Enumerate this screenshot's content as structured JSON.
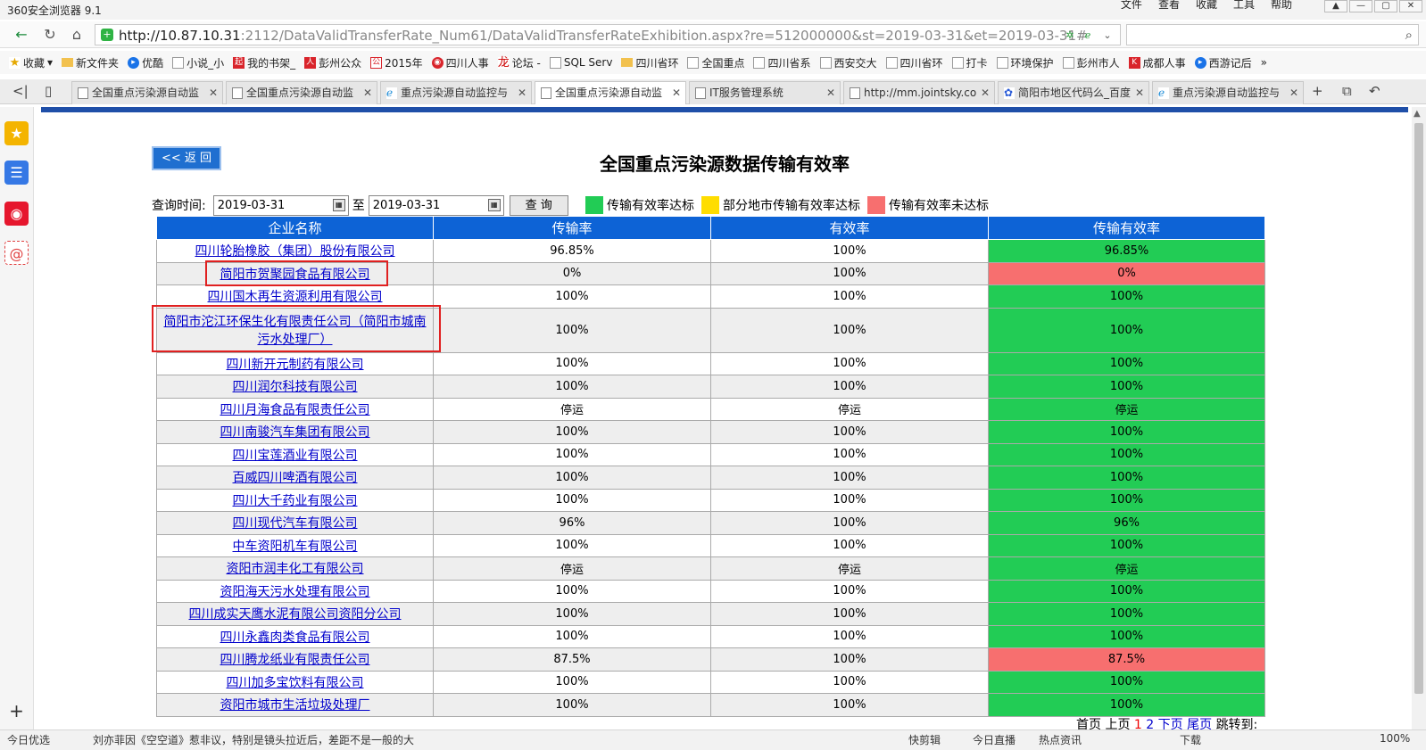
{
  "browser": {
    "app_title": "360安全浏览器 9.1",
    "menus": [
      "文件",
      "查看",
      "收藏",
      "工具",
      "帮助"
    ],
    "url_host": "http://10.87.10.31",
    "url_rest": ":2112/DataValidTransferRate_Num61/DataValidTransferRateExhibition.aspx?re=512000000&st=2019-03-31&et=2019-03-31#",
    "bookmarks": [
      "收藏",
      "新文件夹",
      "优酷",
      "小说_小",
      "我的书架_",
      "彭州公众",
      "2015年",
      "四川人事",
      "论坛 -",
      "SQL Serv",
      "四川省环",
      "全国重点",
      "四川省系",
      "西安交大",
      "四川省环",
      "打卡",
      "环境保护",
      "彭州市人",
      "成都人事",
      "西游记后"
    ],
    "tabs": [
      "全国重点污染源自动监",
      "全国重点污染源自动监",
      "重点污染源自动监控与",
      "全国重点污染源自动监",
      "IT服务管理系统",
      "http://mm.jointsky.co",
      "简阳市地区代码么_百度",
      "重点污染源自动监控与"
    ],
    "status": [
      "今日优选",
      "刘亦菲因《空空道》惹非议，特别是镜头拉近后，差距不是一般的大",
      "快剪辑",
      "今日直播",
      "热点资讯",
      "下载",
      "100%"
    ]
  },
  "page": {
    "back_label": "<< 返 回",
    "title": "全国重点污染源数据传输有效率",
    "query_label": "查询时间:",
    "date_from": "2019-03-31",
    "to_label": "至",
    "date_to": "2019-03-31",
    "query_button": "查 询",
    "legend": [
      {
        "label": "传输有效率达标",
        "color": "#22cc55"
      },
      {
        "label": "部分地市传输有效率达标",
        "color": "#ffdd00"
      },
      {
        "label": "传输有效率未达标",
        "color": "#f76f6f"
      }
    ],
    "colors": {
      "header": "#0d63d6",
      "ok": "#22cc55",
      "bad": "#f76f6f",
      "highlight": "#e02020"
    }
  },
  "table": {
    "columns": [
      "企业名称",
      "传输率",
      "有效率",
      "传输有效率"
    ],
    "rows": [
      {
        "name": "四川轮胎橡胶（集团）股份有限公司",
        "transfer": "96.85%",
        "valid": "100%",
        "rate": "96.85%",
        "status": "ok"
      },
      {
        "name": "简阳市贺聚园食品有限公司",
        "transfer": "0%",
        "valid": "100%",
        "rate": "0%",
        "status": "bad"
      },
      {
        "name": "四川国木再生资源利用有限公司",
        "transfer": "100%",
        "valid": "100%",
        "rate": "100%",
        "status": "ok"
      },
      {
        "name": "简阳市沱江环保生化有限责任公司（简阳市城南污水处理厂）",
        "transfer": "100%",
        "valid": "100%",
        "rate": "100%",
        "status": "ok"
      },
      {
        "name": "四川新开元制药有限公司",
        "transfer": "100%",
        "valid": "100%",
        "rate": "100%",
        "status": "ok"
      },
      {
        "name": "四川润尔科技有限公司",
        "transfer": "100%",
        "valid": "100%",
        "rate": "100%",
        "status": "ok"
      },
      {
        "name": "四川月海食品有限责任公司",
        "transfer": "停运",
        "valid": "停运",
        "rate": "停运",
        "status": "ok"
      },
      {
        "name": "四川南骏汽车集团有限公司",
        "transfer": "100%",
        "valid": "100%",
        "rate": "100%",
        "status": "ok"
      },
      {
        "name": "四川宝莲酒业有限公司",
        "transfer": "100%",
        "valid": "100%",
        "rate": "100%",
        "status": "ok"
      },
      {
        "name": "百威四川啤酒有限公司",
        "transfer": "100%",
        "valid": "100%",
        "rate": "100%",
        "status": "ok"
      },
      {
        "name": "四川大千药业有限公司",
        "transfer": "100%",
        "valid": "100%",
        "rate": "100%",
        "status": "ok"
      },
      {
        "name": "四川现代汽车有限公司",
        "transfer": "96%",
        "valid": "100%",
        "rate": "96%",
        "status": "ok"
      },
      {
        "name": "中车资阳机车有限公司",
        "transfer": "100%",
        "valid": "100%",
        "rate": "100%",
        "status": "ok"
      },
      {
        "name": "资阳市润丰化工有限公司",
        "transfer": "停运",
        "valid": "停运",
        "rate": "停运",
        "status": "ok"
      },
      {
        "name": "资阳海天污水处理有限公司",
        "transfer": "100%",
        "valid": "100%",
        "rate": "100%",
        "status": "ok"
      },
      {
        "name": "四川成实天鹰水泥有限公司资阳分公司",
        "transfer": "100%",
        "valid": "100%",
        "rate": "100%",
        "status": "ok"
      },
      {
        "name": "四川永鑫肉类食品有限公司",
        "transfer": "100%",
        "valid": "100%",
        "rate": "100%",
        "status": "ok"
      },
      {
        "name": "四川腾龙纸业有限责任公司",
        "transfer": "87.5%",
        "valid": "100%",
        "rate": "87.5%",
        "status": "bad"
      },
      {
        "name": "四川加多宝饮料有限公司",
        "transfer": "100%",
        "valid": "100%",
        "rate": "100%",
        "status": "ok"
      },
      {
        "name": "资阳市城市生活垃圾处理厂",
        "transfer": "100%",
        "valid": "100%",
        "rate": "100%",
        "status": "ok"
      }
    ]
  },
  "pager": {
    "first": "首页",
    "prev": "上页",
    "page1": "1",
    "page2": "2",
    "next": "下页",
    "last": "尾页",
    "jump": "跳转到:"
  }
}
